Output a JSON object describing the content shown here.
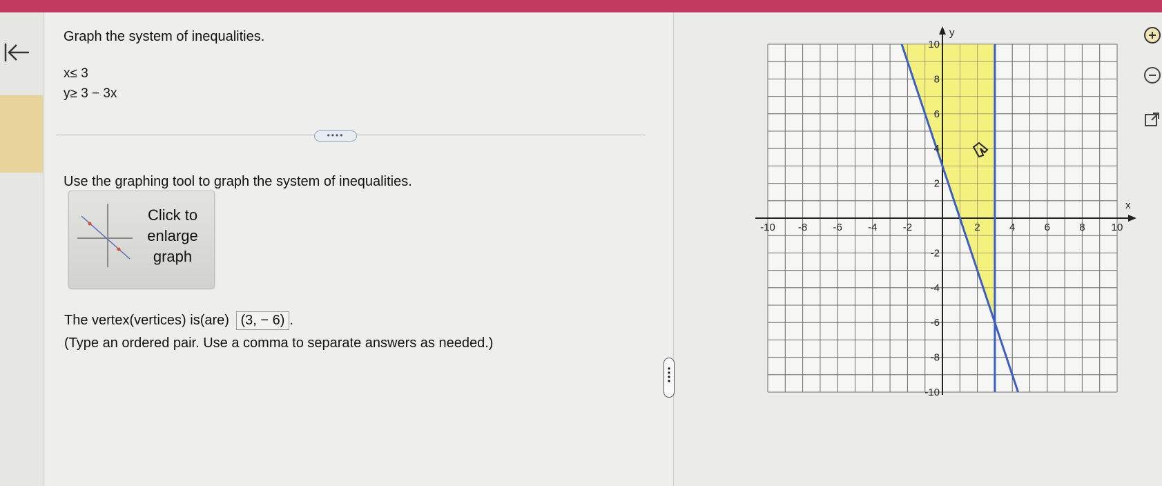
{
  "question": {
    "title": "Graph the system of inequalities.",
    "inequalities": [
      "x≤ 3",
      "y≥ 3 − 3x"
    ],
    "more_button": "••••",
    "instruction": "Use the graphing tool to graph the system of inequalities.",
    "enlarge_button": [
      "Click to",
      "enlarge",
      "graph"
    ],
    "vertex_label": "The vertex(vertices) is(are)",
    "vertex_value": "(3, − 6)",
    "vertex_trailing": ".",
    "hint": "(Type an ordered pair. Use a comma to separate answers as needed.)"
  },
  "icons": {
    "back": "back-arrow-icon",
    "zoom_in": "zoom-in-icon",
    "zoom_out": "zoom-out-icon",
    "external": "open-external-icon",
    "cursor": "hand-cursor-icon"
  },
  "colors": {
    "header": "#c03a5e",
    "shade": "#f3f06a",
    "boundary_line": "#3b5fc0",
    "rail_tab": "#e8d49a"
  },
  "chart_data": {
    "type": "line",
    "xlabel": "x",
    "ylabel": "y",
    "xlim": [
      -10,
      10
    ],
    "ylim": [
      -10,
      10
    ],
    "grid": true,
    "x_tick_labels": [
      "-10",
      "-8",
      "-6",
      "-4",
      "-2",
      "2",
      "4",
      "6",
      "8",
      "10"
    ],
    "y_tick_labels": [
      "10",
      "8",
      "6",
      "4",
      "2",
      "-2",
      "-4",
      "-6",
      "-8",
      "-10"
    ],
    "lines": [
      {
        "equation": "y = 3 - 3x",
        "points": [
          [
            -2.33,
            10
          ],
          [
            4.33,
            -10
          ]
        ]
      },
      {
        "equation": "x = 3",
        "points": [
          [
            3,
            10
          ],
          [
            3,
            -10
          ]
        ]
      }
    ],
    "shaded_region": {
      "description": "x ≤ 3 and y ≥ 3 − 3x",
      "polygon": [
        [
          -2.33,
          10
        ],
        [
          3,
          10
        ],
        [
          3,
          -6
        ]
      ]
    }
  }
}
